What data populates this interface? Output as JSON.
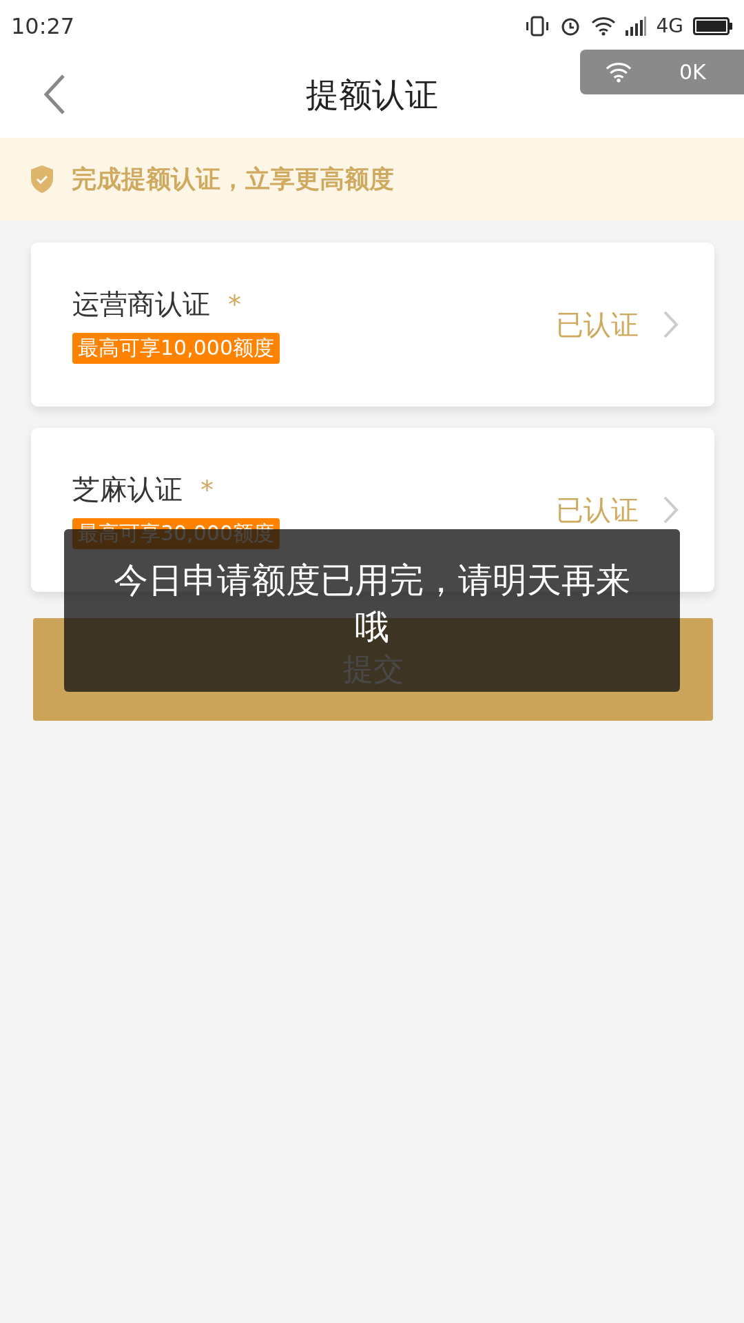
{
  "status_bar": {
    "time": "10:27",
    "network": "4G"
  },
  "speed_widget": {
    "reading": "0K"
  },
  "header": {
    "title": "提额认证"
  },
  "banner": {
    "text": "完成提额认证，立享更高额度"
  },
  "items": [
    {
      "title": "运营商认证",
      "mark": "*",
      "badge": "最高可享10,000额度",
      "status": "已认证"
    },
    {
      "title": "芝麻认证",
      "mark": "*",
      "badge": "最高可享30,000额度",
      "status": "已认证"
    }
  ],
  "submit_button": {
    "label": "提交"
  },
  "toast": {
    "text": "今日申请额度已用完，请明天再来哦"
  }
}
